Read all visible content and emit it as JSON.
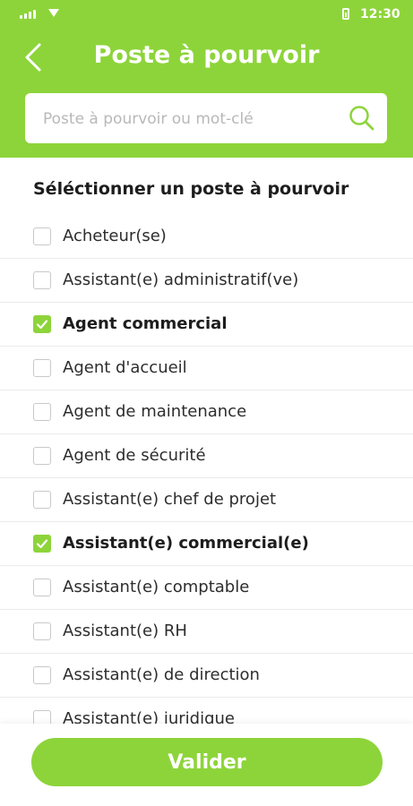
{
  "status_bar": {
    "time": "12:30"
  },
  "header": {
    "title": "Poste à pourvoir"
  },
  "search": {
    "placeholder": "Poste à pourvoir ou mot-clé",
    "value": ""
  },
  "section": {
    "title": "Séléctionner un poste à pourvoir"
  },
  "items": [
    {
      "label": "Acheteur(se)",
      "checked": false
    },
    {
      "label": "Assistant(e) administratif(ve)",
      "checked": false
    },
    {
      "label": "Agent commercial",
      "checked": true
    },
    {
      "label": "Agent d'accueil",
      "checked": false
    },
    {
      "label": "Agent de maintenance",
      "checked": false
    },
    {
      "label": "Agent de sécurité",
      "checked": false
    },
    {
      "label": "Assistant(e) chef de projet",
      "checked": false
    },
    {
      "label": "Assistant(e) commercial(e)",
      "checked": true
    },
    {
      "label": "Assistant(e) comptable",
      "checked": false
    },
    {
      "label": "Assistant(e) RH",
      "checked": false
    },
    {
      "label": "Assistant(e) de direction",
      "checked": false
    },
    {
      "label": "Assistant(e) juridique",
      "checked": false
    }
  ],
  "footer": {
    "validate_label": "Valider"
  },
  "colors": {
    "accent": "#8dd43a"
  }
}
